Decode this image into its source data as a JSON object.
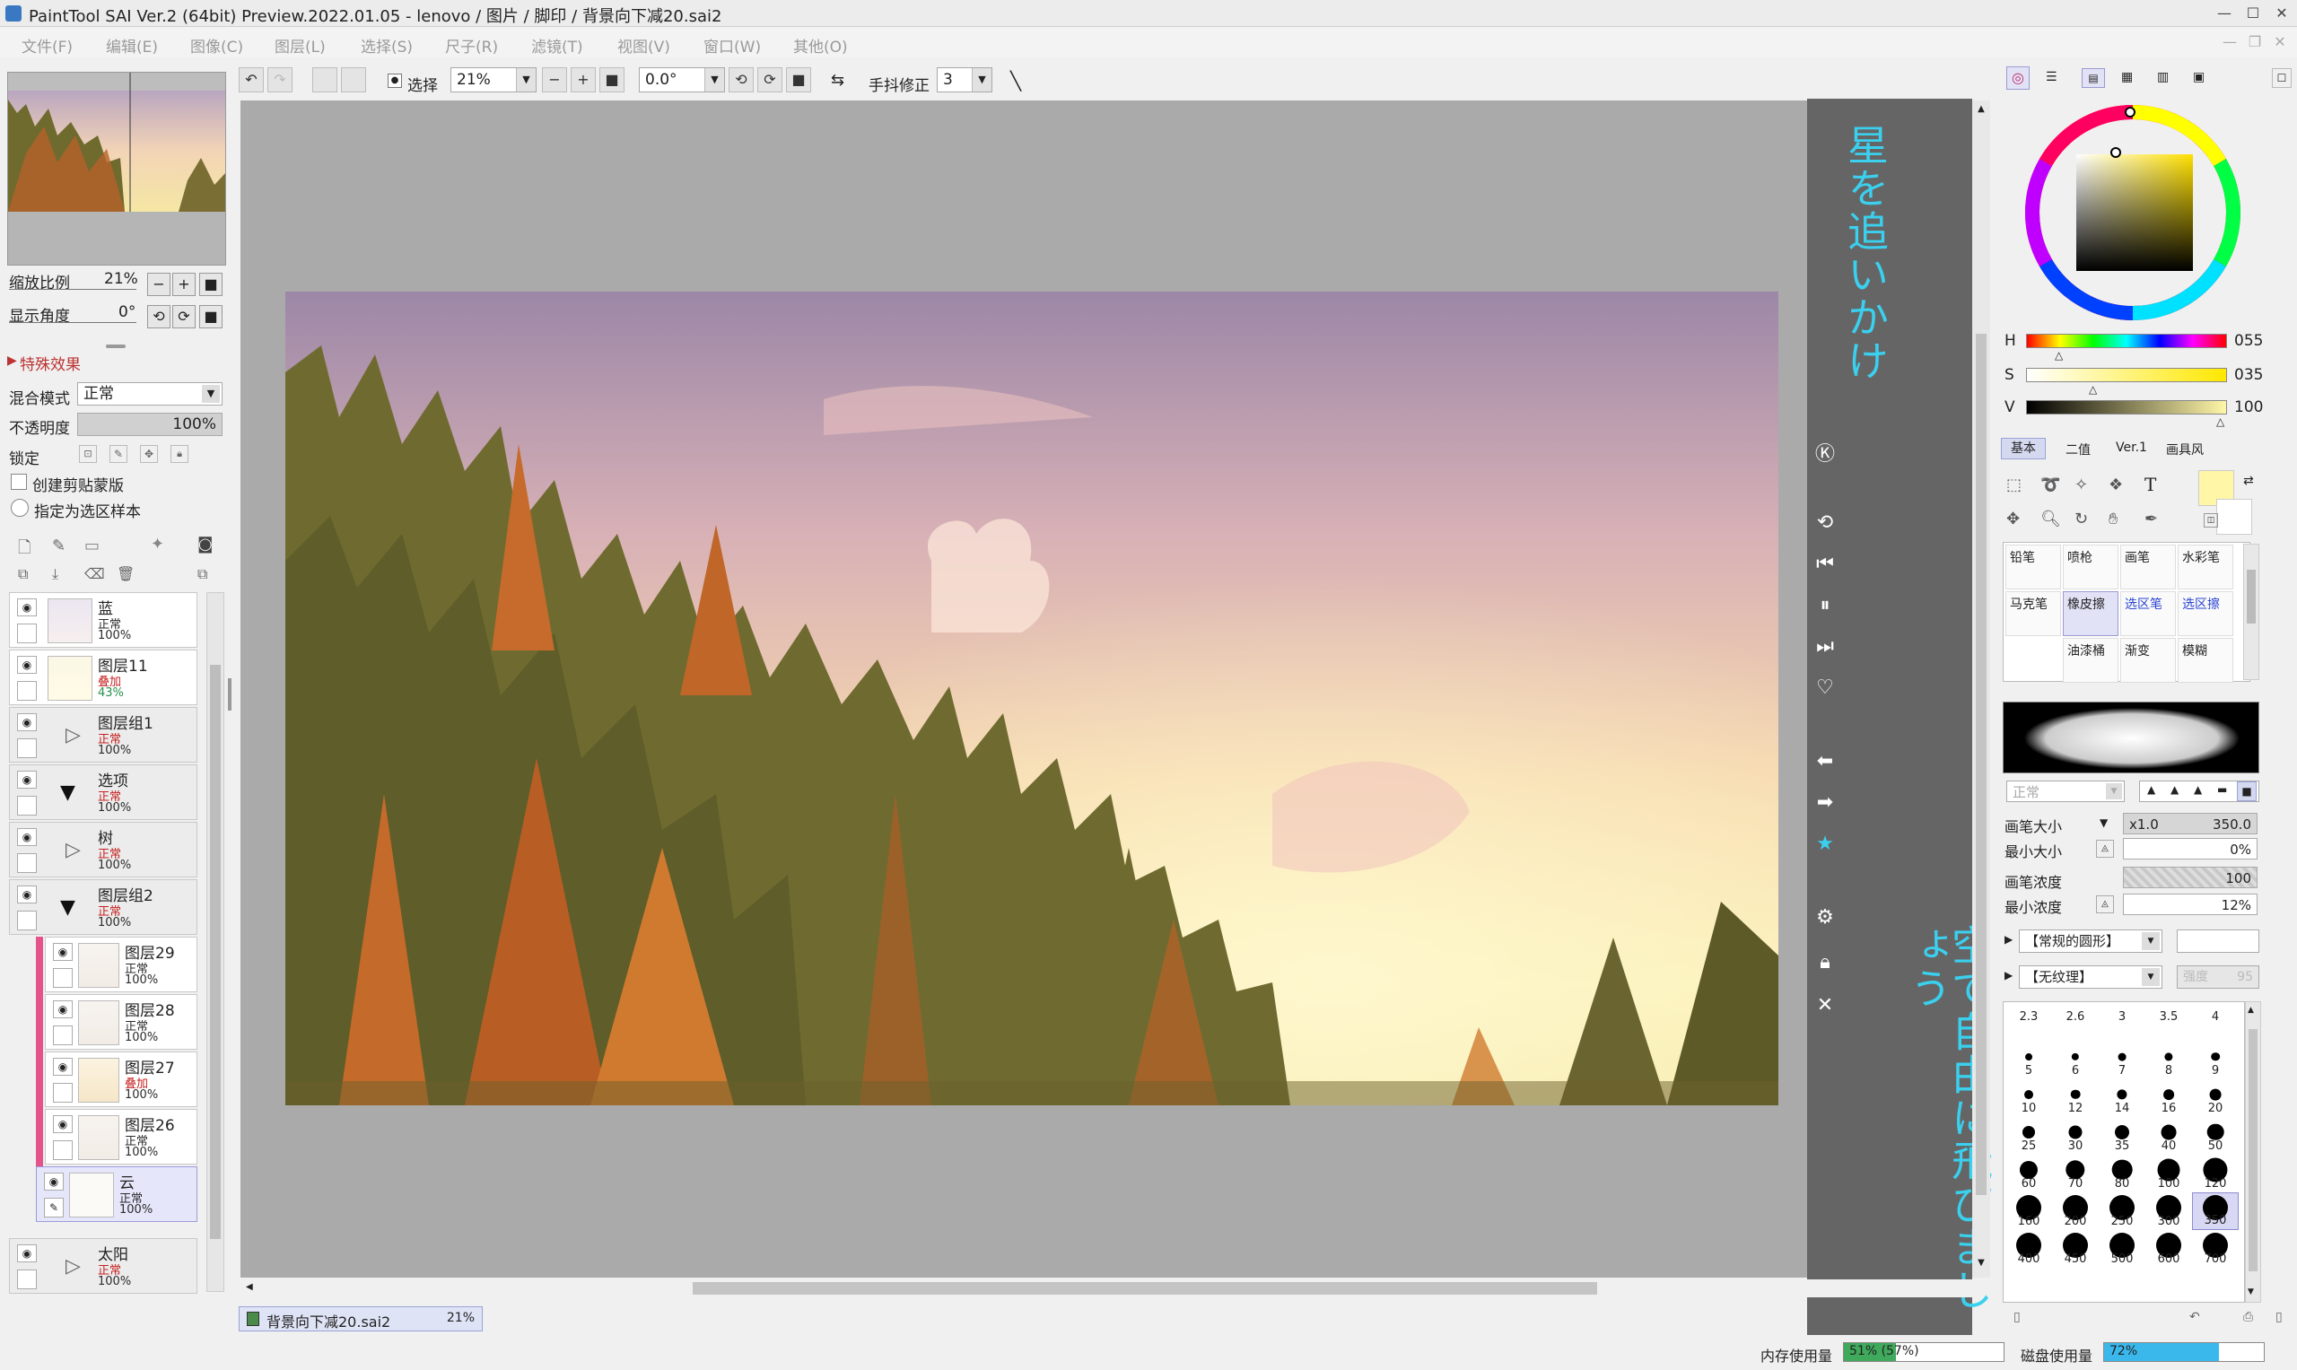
{
  "window": {
    "title": "PaintTool SAI Ver.2 (64bit) Preview.2022.01.05 - lenovo / 图片 / 脚印 / 背景向下减20.sai2"
  },
  "menu": [
    "文件(F)",
    "编辑(E)",
    "图像(C)",
    "图层(L)",
    "选择(S)",
    "尺子(R)",
    "滤镜(T)",
    "视图(V)",
    "窗口(W)",
    "其他(O)"
  ],
  "toolbar": {
    "select_label": "选择",
    "zoom": "21%",
    "angle": "0.0°",
    "stabilizer_label": "手抖修正",
    "stabilizer_value": "3"
  },
  "navigator": {
    "zoom_label": "缩放比例",
    "zoom_value": "21%",
    "angle_label": "显示角度",
    "angle_value": "0°"
  },
  "layer_props": {
    "effects_label": "特殊效果",
    "blend_label": "混合模式",
    "blend_value": "正常",
    "opacity_label": "不透明度",
    "opacity_value": "100%",
    "lock_label": "锁定",
    "clip_label": "创建剪贴蒙版",
    "sample_label": "指定为选区样本"
  },
  "layers": [
    {
      "name": "蓝",
      "mode": "正常",
      "opacity": "100%",
      "group": false
    },
    {
      "name": "图层11",
      "mode": "叠加",
      "opacity": "43%",
      "group": false
    },
    {
      "name": "图层组1",
      "mode": "正常",
      "opacity": "100%",
      "group": true
    },
    {
      "name": "选项",
      "mode": "正常",
      "opacity": "100%",
      "group": true
    },
    {
      "name": "树",
      "mode": "正常",
      "opacity": "100%",
      "group": true
    },
    {
      "name": "图层组2",
      "mode": "正常",
      "opacity": "100%",
      "group": true
    },
    {
      "name": "图层29",
      "mode": "正常",
      "opacity": "100%",
      "group": false
    },
    {
      "name": "图层28",
      "mode": "正常",
      "opacity": "100%",
      "group": false
    },
    {
      "name": "图层27",
      "mode": "叠加",
      "opacity": "100%",
      "group": false
    },
    {
      "name": "图层26",
      "mode": "正常",
      "opacity": "100%",
      "group": false
    },
    {
      "name": "云",
      "mode": "正常",
      "opacity": "100%",
      "group": false
    },
    {
      "name": "太阳",
      "mode": "正常",
      "opacity": "100%",
      "group": true
    }
  ],
  "overlay": {
    "text_top": "星を追いかけ",
    "text_bottom": "空で自由に飛びましょう"
  },
  "color": {
    "h_label": "H",
    "h_value": "055",
    "s_label": "S",
    "s_value": "035",
    "v_label": "V",
    "v_value": "100",
    "current": "#fff6a8"
  },
  "tool_tabs": [
    "基本",
    "二值",
    "Ver.1",
    "画具风"
  ],
  "tools": [
    "铅笔",
    "喷枪",
    "画笔",
    "水彩笔",
    "马克笔",
    "橡皮擦",
    "选区笔",
    "选区擦",
    "油漆桶",
    "渐变",
    "模糊"
  ],
  "brush_settings": {
    "mode": "正常",
    "size_label": "画笔大小",
    "size_mult": "x1.0",
    "size_value": "350.0",
    "min_size_label": "最小大小",
    "min_size_value": "0%",
    "density_label": "画笔浓度",
    "density_value": "100",
    "min_density_label": "最小浓度",
    "min_density_value": "12%",
    "shape": "【常规的圆形】",
    "texture": "【无纹理】",
    "texture_strength_label": "强度",
    "texture_strength_value": "95"
  },
  "brush_sizes": [
    "2.3",
    "2.6",
    "3",
    "3.5",
    "4",
    "5",
    "6",
    "7",
    "8",
    "9",
    "10",
    "12",
    "14",
    "16",
    "20",
    "25",
    "30",
    "35",
    "40",
    "50",
    "60",
    "70",
    "80",
    "100",
    "120",
    "160",
    "200",
    "250",
    "300",
    "350",
    "400",
    "450",
    "500",
    "600",
    "700"
  ],
  "document_tab": {
    "name": "背景向下减20.sai2",
    "zoom": "21%"
  },
  "status": {
    "mem_label": "内存使用量",
    "mem_value": "51% (57%)",
    "disk_label": "磁盘使用量",
    "disk_value": "72%"
  }
}
